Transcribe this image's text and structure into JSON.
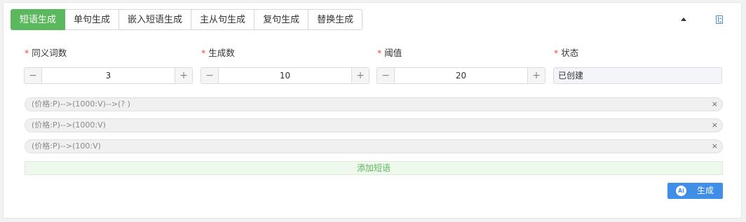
{
  "tabs": [
    {
      "label": "短语生成",
      "active": true
    },
    {
      "label": "单句生成",
      "active": false
    },
    {
      "label": "嵌入短语生成",
      "active": false
    },
    {
      "label": "主从句生成",
      "active": false
    },
    {
      "label": "复句生成",
      "active": false
    },
    {
      "label": "替换生成",
      "active": false
    }
  ],
  "icons": {
    "collapse": "caret-up-icon",
    "doc": "book-icon"
  },
  "fields": {
    "synonyms": {
      "required_mark": "*",
      "label": "同义词数",
      "value": "3",
      "minus": "−",
      "plus": "+"
    },
    "gen_count": {
      "required_mark": "*",
      "label": "生成数",
      "value": "10",
      "minus": "−",
      "plus": "+"
    },
    "threshold": {
      "required_mark": "*",
      "label": "阈值",
      "value": "20",
      "minus": "−",
      "plus": "+"
    },
    "status": {
      "required_mark": "*",
      "label": "状态",
      "value": "已创建"
    }
  },
  "phrases": [
    {
      "text": "(价格:P)-->(1000:V)-->(?  )",
      "close": "×"
    },
    {
      "text": "(价格:P)-->(1000:V)",
      "close": "×"
    },
    {
      "text": "(价格:P)-->(100:V)",
      "close": "×"
    }
  ],
  "add_phrase_label": "添加短语",
  "generate": {
    "icon_text": "Ai",
    "label": "生成"
  },
  "colors": {
    "accent_green": "#5cb85c",
    "accent_blue": "#3f8ee8",
    "required": "#e74c3c"
  }
}
